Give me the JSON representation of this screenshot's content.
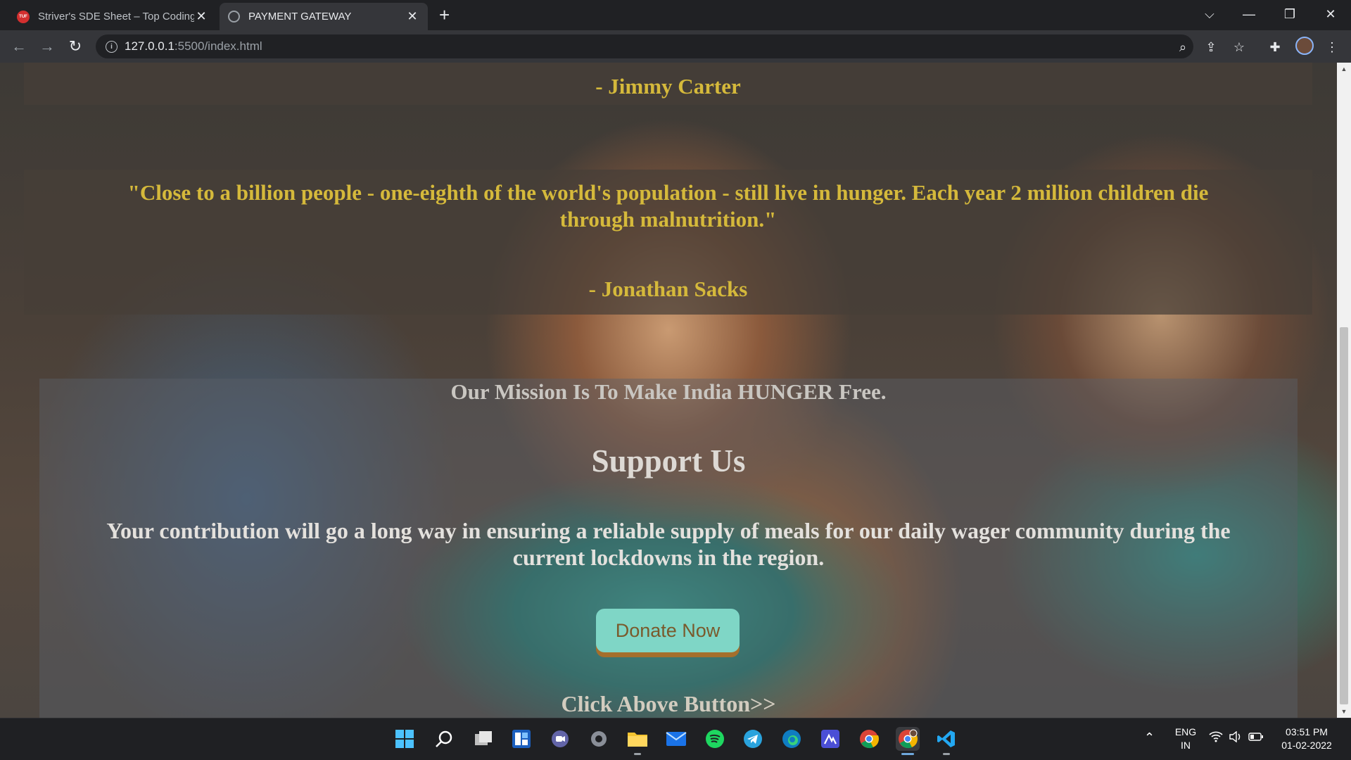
{
  "browser": {
    "tabs": [
      {
        "title": "Striver's SDE Sheet – Top Coding",
        "icon": "tuf-favicon",
        "favicon_text": "TUF",
        "active": false
      },
      {
        "title": "PAYMENT GATEWAY",
        "icon": "globe-icon",
        "active": true
      }
    ],
    "url_host": "127.0.0.1",
    "url_rest": ":5500/index.html"
  },
  "page": {
    "quotes": [
      {
        "text": "",
        "author": "- Jimmy Carter"
      },
      {
        "text": "\"Close to a billion people - one-eighth of the world's population - still live in hunger. Each year 2 million children die through malnutrition.\"",
        "author": "- Jonathan Sacks"
      }
    ],
    "mission": "Our Mission Is To Make India HUNGER Free.",
    "support_title": "Support Us",
    "contribution": "Your contribution will go a long way in ensuring a reliable supply of meals for our daily wager community during the current lockdowns in the region.",
    "donate_label": "Donate Now",
    "click_above": "Click Above Button>>"
  },
  "colors": {
    "quote_gold": "#d5b93b",
    "donate_bg": "#7fd6c6",
    "donate_shadow": "#a46f2c"
  },
  "taskbar": {
    "apps": [
      "start-icon",
      "search-icon",
      "task-view-icon",
      "widgets-icon",
      "teams-chat-icon",
      "settings-icon",
      "file-explorer-icon",
      "mail-icon",
      "spotify-icon",
      "telegram-icon",
      "edge-icon",
      "stremio-icon",
      "chrome-icon",
      "chrome-profile-icon",
      "vscode-icon"
    ],
    "lang_top": "ENG",
    "lang_bottom": "IN",
    "time": "03:51 PM",
    "date": "01-02-2022"
  }
}
